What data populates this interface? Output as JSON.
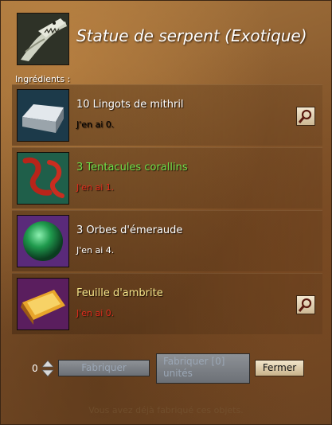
{
  "title": "Statue de serpent (Exotique)",
  "ingredients_label": "Ingrédients :",
  "ingredients": [
    {
      "name": "10 Lingots de mithril",
      "have": "J'en ai 0.",
      "name_color": "#ffffff",
      "have_color": "#e02b1d",
      "icon": "mithril-ingot-icon",
      "has_search": true
    },
    {
      "name": "3 Tentacules corallins",
      "have": "J'en ai 1.",
      "name_color": "#6fe04a",
      "have_color": "#e02b1d",
      "icon": "coral-tentacle-icon",
      "has_search": false
    },
    {
      "name": "3 Orbes d'émeraude",
      "have": "J'en ai 4.",
      "name_color": "#ffffff",
      "have_color": "#ffffff",
      "icon": "emerald-orb-icon",
      "has_search": false
    },
    {
      "name": "Feuille d'ambrite",
      "have": "J'en ai 0.",
      "name_color": "#f5e58a",
      "have_color": "#e02b1d",
      "icon": "ambrite-sheet-icon",
      "has_search": true
    }
  ],
  "quantity": "0",
  "buttons": {
    "craft": "Fabriquer",
    "craft_all": "Fabriquer [0] unités",
    "close": "Fermer"
  },
  "status_text": "Vous avez déjà fabriqué ces objets."
}
